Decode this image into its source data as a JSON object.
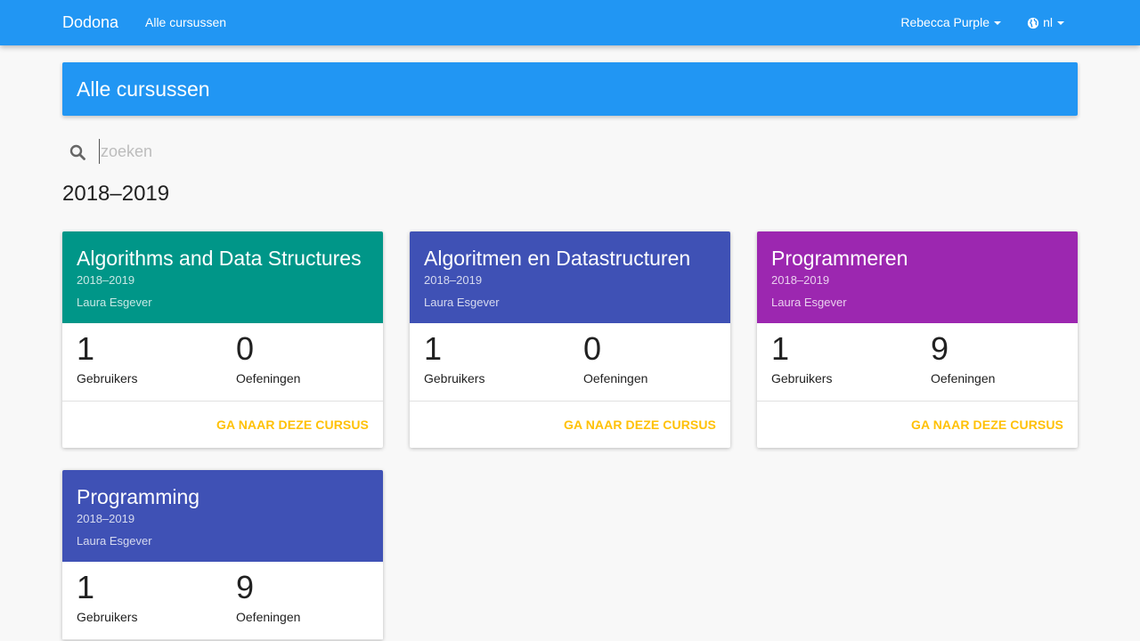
{
  "navbar": {
    "brand": "Dodona",
    "link_all_courses": "Alle cursussen",
    "user_name": "Rebecca Purple",
    "language": "nl",
    "color": "#2196f3"
  },
  "header": {
    "title": "Alle cursussen"
  },
  "search": {
    "placeholder": "zoeken",
    "value": ""
  },
  "section": {
    "year": "2018–2019"
  },
  "courses": [
    {
      "title": "Algorithms and Data Structures",
      "year": "2018–2019",
      "teacher": "Laura Esgever",
      "users": "1",
      "users_label": "Gebruikers",
      "exercises": "0",
      "exercises_label": "Oefeningen",
      "action": "GA NAAR DEZE CURSUS",
      "color": "#009688"
    },
    {
      "title": "Algoritmen en Datastructuren",
      "year": "2018–2019",
      "teacher": "Laura Esgever",
      "users": "1",
      "users_label": "Gebruikers",
      "exercises": "0",
      "exercises_label": "Oefeningen",
      "action": "GA NAAR DEZE CURSUS",
      "color": "#3f51b5"
    },
    {
      "title": "Programmeren",
      "year": "2018–2019",
      "teacher": "Laura Esgever",
      "users": "1",
      "users_label": "Gebruikers",
      "exercises": "9",
      "exercises_label": "Oefeningen",
      "action": "GA NAAR DEZE CURSUS",
      "color": "#9c27b0"
    },
    {
      "title": "Programming",
      "year": "2018–2019",
      "teacher": "Laura Esgever",
      "users": "1",
      "users_label": "Gebruikers",
      "exercises": "9",
      "exercises_label": "Oefeningen",
      "action": "GA NAAR DEZE CURSUS",
      "color": "#3f51b5"
    }
  ],
  "icons": {
    "search": "search-icon",
    "language": "globe-icon",
    "dropdown": "caret-down-icon"
  },
  "accent_color": "#ffc107"
}
